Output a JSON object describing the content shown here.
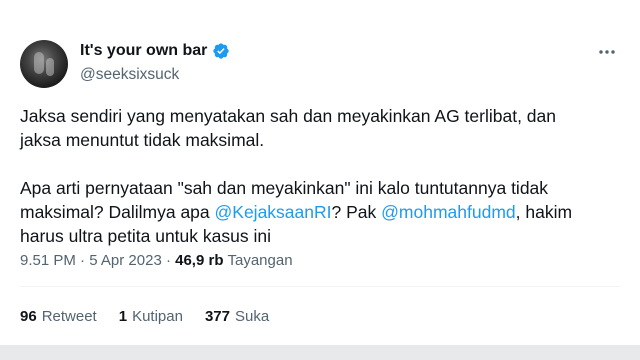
{
  "author": {
    "display_name": "It's your own bar",
    "handle": "@seeksixsuck"
  },
  "tweet": {
    "line1": "Jaksa sendiri yang menyatakan sah dan meyakinkan AG terlibat, dan",
    "line2": "jaksa menuntut tidak maksimal.",
    "para2_line1": "Apa arti pernyataan \"sah dan meyakinkan\" ini kalo tuntutannya tidak",
    "para2_line2_pre": "maksimal? Dalilmya apa ",
    "mention1": "@KejaksaanRI",
    "para2_line2_mid": "? Pak ",
    "mention2": "@mohmahfudmd",
    "para2_line2_post": ", hakim",
    "para2_line3": "harus ultra petita untuk kasus ini"
  },
  "meta": {
    "time": "9.51 PM",
    "separator": " · ",
    "date": "5 Apr 2023",
    "separator2": " · ",
    "views": "46,9 rb",
    "views_label": "Tayangan"
  },
  "stats": {
    "retweets_count": "96",
    "retweets_label": "Retweet",
    "quotes_count": "1",
    "quotes_label": "Kutipan",
    "likes_count": "377",
    "likes_label": "Suka"
  },
  "colors": {
    "link": "#1d9bf0",
    "verified": "#1d9bf0",
    "secondary_text": "#536471",
    "primary_text": "#0f1419"
  }
}
